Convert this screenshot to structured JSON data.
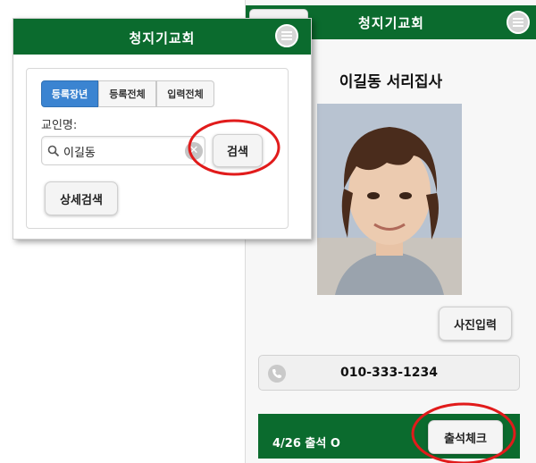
{
  "colors": {
    "header_green": "#0b6b2e",
    "active_tab_blue": "#3b84d1",
    "annotation_red": "#e11b1b"
  },
  "search_screen": {
    "header": {
      "title": "청지기교회",
      "menu_icon": "menu-icon"
    },
    "tabs": [
      {
        "label": "등록장년",
        "active": true
      },
      {
        "label": "등록전체",
        "active": false
      },
      {
        "label": "입력전체",
        "active": false
      }
    ],
    "field_label": "교인명:",
    "search_input": {
      "value": "이길동",
      "icon": "search-icon",
      "clear_icon": "clear-icon"
    },
    "search_button": "검색",
    "detail_search_button": "상세검색"
  },
  "detail_screen": {
    "header": {
      "title": "청지기교회",
      "menu_icon": "menu-icon",
      "back_icon": "back-icon"
    },
    "person_name": "이길동 서리집사",
    "photo_button": "사진입력",
    "phone": {
      "icon": "phone-icon",
      "number": "010-333-1234"
    },
    "attendance": {
      "status": "4/26 출석 O",
      "check_button": "출석체크"
    }
  }
}
